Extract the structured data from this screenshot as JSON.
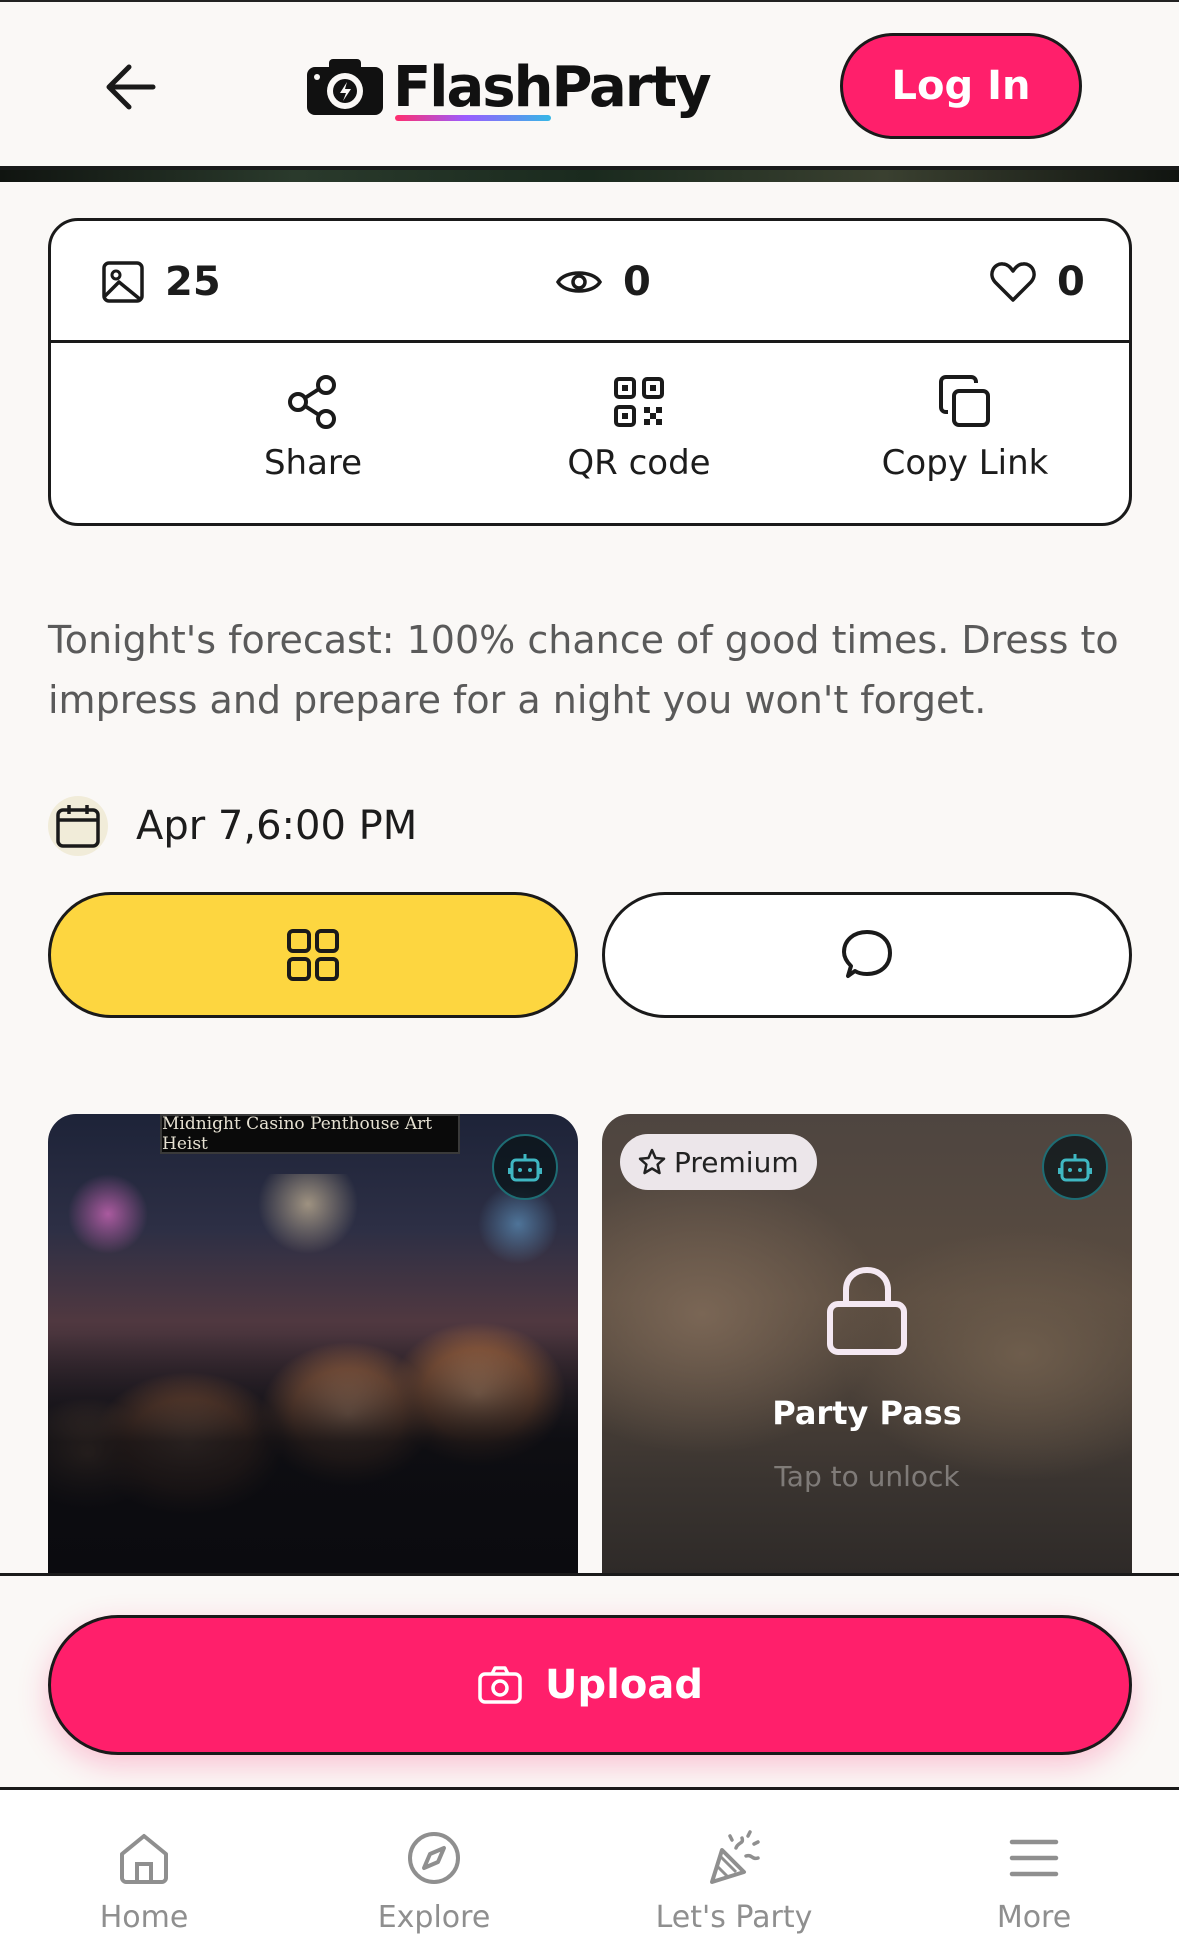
{
  "header": {
    "app_name": "FlashParty",
    "login_label": "Log In"
  },
  "stats": {
    "photos": "25",
    "views": "0",
    "likes": "0"
  },
  "actions": {
    "share": "Share",
    "qr": "QR code",
    "copy": "Copy Link"
  },
  "event": {
    "description": "Tonight's forecast: 100% chance of good times. Dress to impress and prepare for a night you won't forget.",
    "date": "Apr 7,6:00 PM"
  },
  "gallery": {
    "photo_banner": "Midnight Casino Penthouse Art Heist",
    "premium_label": "Premium",
    "locked_title": "Party Pass",
    "locked_hint": "Tap to unlock"
  },
  "upload": {
    "label": "Upload"
  },
  "nav": {
    "home": "Home",
    "explore": "Explore",
    "party": "Let's Party",
    "more": "More"
  },
  "colors": {
    "accent": "#ff1f6b",
    "grid_toggle": "#fdd640",
    "bot_badge_border": "#1e6d74"
  }
}
